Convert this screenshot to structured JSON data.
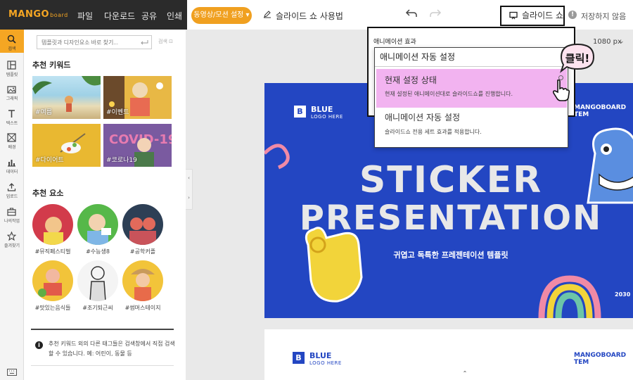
{
  "topbar": {
    "logo": "MANGO",
    "logo_sub": "board",
    "menu": [
      "파일",
      "다운로드",
      "공유",
      "인쇄"
    ],
    "cta_label": "동영상/모션 설정",
    "help_label": "슬라이드 쇼 사용법",
    "slideshow_label": "슬라이드 쇼",
    "save_status": "저장하지 않음"
  },
  "rail": {
    "items": [
      {
        "label": "검색",
        "icon": "search-icon",
        "active": true
      },
      {
        "label": "템플릿",
        "icon": "template-icon"
      },
      {
        "label": "그래픽",
        "icon": "graphic-icon"
      },
      {
        "label": "텍스트",
        "icon": "text-icon"
      },
      {
        "label": "배경",
        "icon": "background-icon"
      },
      {
        "label": "데이터",
        "icon": "chart-icon"
      },
      {
        "label": "업로드",
        "icon": "upload-icon"
      },
      {
        "label": "나의작업",
        "icon": "briefcase-icon"
      },
      {
        "label": "즐겨찾기",
        "icon": "star-icon"
      }
    ]
  },
  "panel": {
    "search_placeholder": "템플릿과 디자인요소 바로 찾기...",
    "search_label": "검색",
    "keywords_title": "추천 키워드",
    "keywords": [
      "#여름",
      "#이벤트",
      "#다이어트",
      "#코로나19"
    ],
    "elements_title": "추천 요소",
    "elements": [
      "#뮤직페스티벌",
      "#수능생8",
      "#공학커플",
      "#맛있는음식들",
      "#조기퇴근씨",
      "#썸머스테이지"
    ],
    "notice": "추천 키워드 외의 다른 태그들은 검색창에서 직접 검색할 수 있습니다. 예: 어린이, 동물 등"
  },
  "canvas": {
    "size_label": "1080 px",
    "slide": {
      "logo_letter": "B",
      "logo_name": "BLUE",
      "logo_sub": "LOGO HERE",
      "brand": "MANGOBOARD TEM",
      "title_line1": "STICKER",
      "title_line2": "PRESENTATION",
      "subtitle": "귀엽고 독특한 프레젠테이션 템플릿",
      "year": "2030"
    },
    "slide2": {
      "logo_letter": "B",
      "logo_name": "BLUE",
      "logo_sub": "LOGO HERE",
      "brand": "MANGOBOARD TEM"
    }
  },
  "popup": {
    "label": "애니메이션 효과",
    "selected": "애니메이션 자동 설정",
    "options": [
      {
        "title": "현재 설정 상태",
        "desc": "현재 설정된 애니메이션대로 슬라이드쇼를 진행합니다."
      },
      {
        "title": "애니메이션 자동 설정",
        "desc": "슬라이드쇼 전용 세트 효과를 적용합니다."
      }
    ],
    "click_text": "클릭!"
  },
  "colors": {
    "accent": "#f5a623",
    "slide_blue": "#2346c2",
    "highlight": "#f2b3f0"
  }
}
